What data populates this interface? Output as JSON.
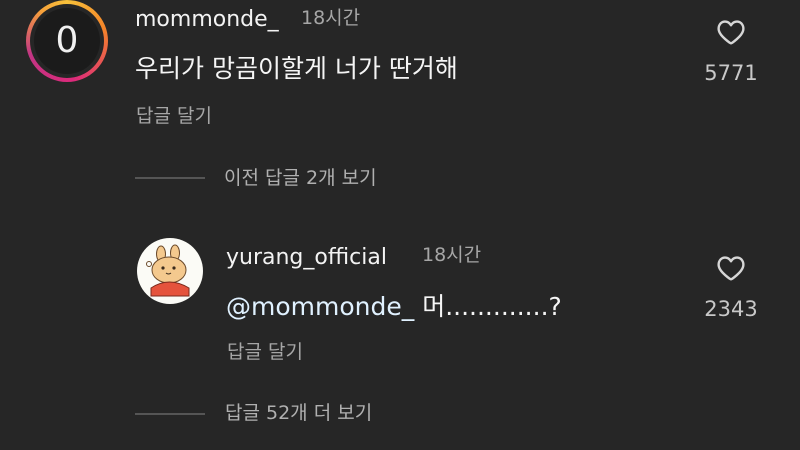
{
  "comment": {
    "avatar_letter": "0",
    "username": "mommonde_",
    "time": "18시간",
    "text": "우리가 망곰이할게 너가 딴거해",
    "reply_label": "답글 달기",
    "like_count": "5771",
    "like_icon": "heart-outline-icon"
  },
  "previous_replies": {
    "label": "이전 답글 2개 보기"
  },
  "reply": {
    "username": "yurang_official",
    "time": "18시간",
    "mention": "@mommonde_",
    "text": "머.............?",
    "reply_label": "답글 달기",
    "like_count": "2343",
    "like_icon": "heart-outline-icon"
  },
  "more_replies": {
    "label": "답글 52개 더 보기"
  },
  "colors": {
    "background": "#262626",
    "mention": "#e0f1ff",
    "secondary_text": "#a6a6a6",
    "story_ring": "#dd2a7b"
  }
}
